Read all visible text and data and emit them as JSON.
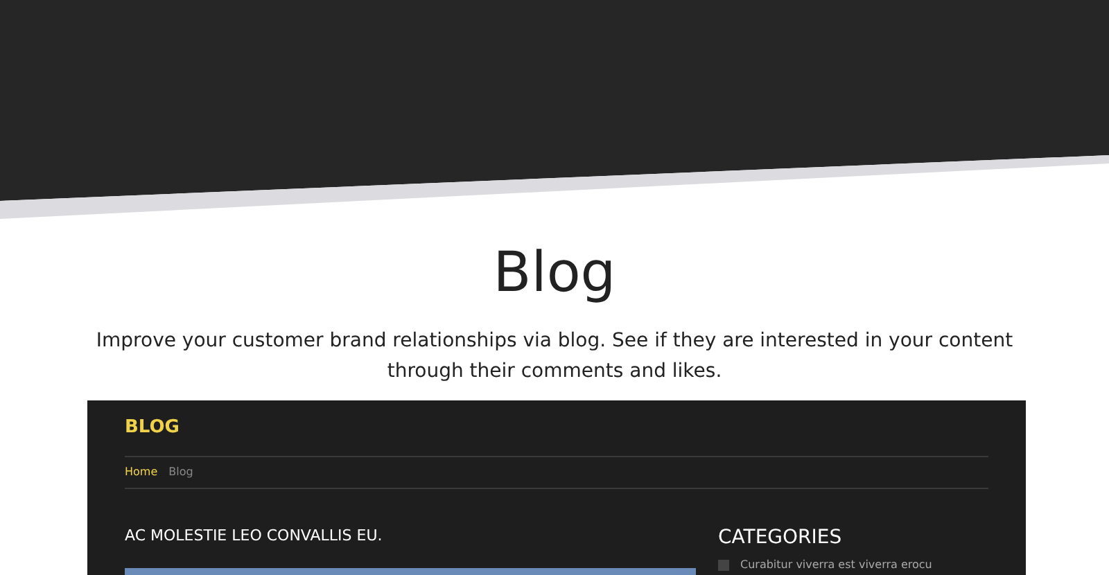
{
  "heading": "Blog",
  "intro": "Improve your customer brand relationships via blog. See if they are interested in your content through their comments and likes.",
  "preview": {
    "title": "BLOG",
    "breadcrumb": [
      {
        "label": "Home",
        "selected": true
      },
      {
        "label": "Blog",
        "selected": false
      }
    ],
    "post_title": "AC MOLESTIE LEO CONVALLIS EU.",
    "sidebar": {
      "title": "CATEGORIES",
      "items": [
        "Curabitur viverra est viverra erocu"
      ]
    }
  }
}
